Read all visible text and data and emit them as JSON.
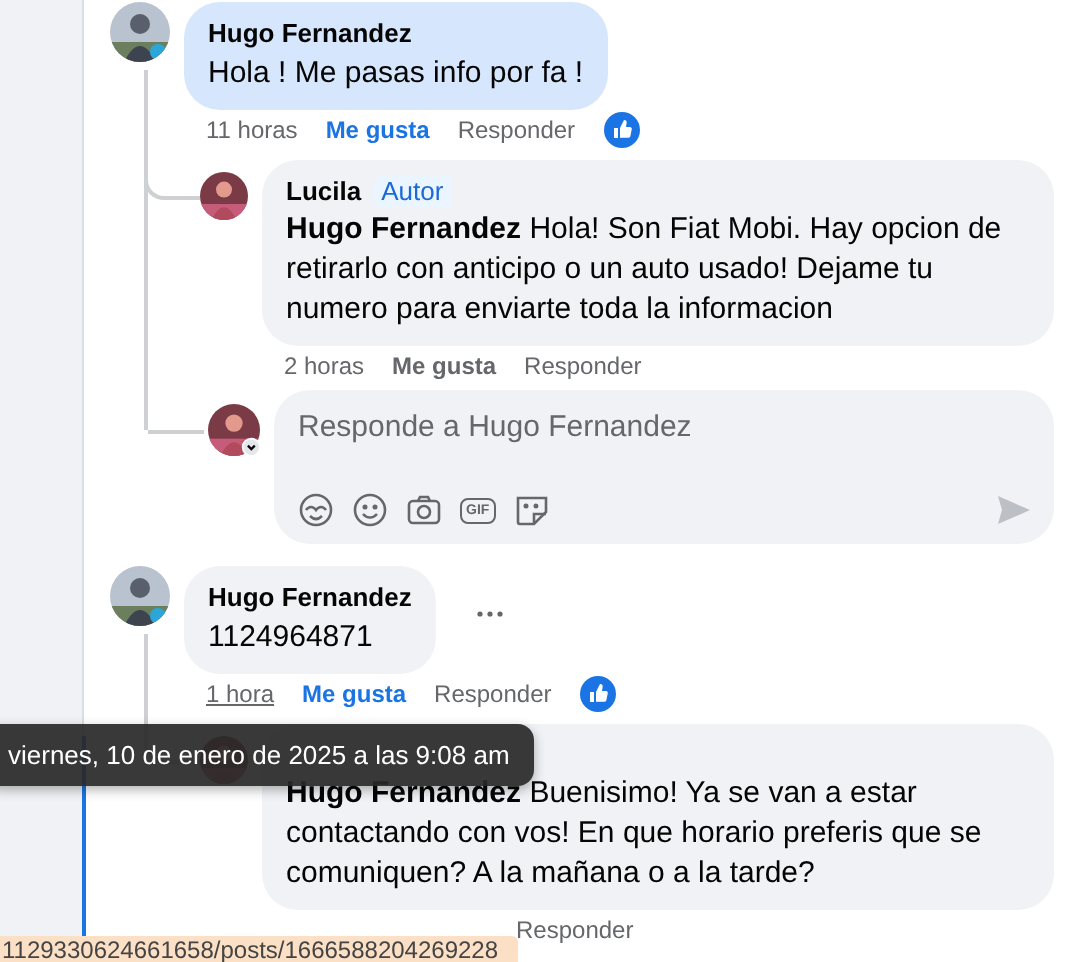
{
  "threads": [
    {
      "comment": {
        "author": "Hugo Fernandez",
        "text": "Hola ! Me pasas info por fa !",
        "highlighted": true,
        "more_button": false,
        "time": "11 horas",
        "time_hovered": false,
        "like": "Me gusta",
        "liked": true,
        "reply": "Responder",
        "reaction": true
      },
      "replies": [
        {
          "author": "Lucila",
          "badge": "Autor",
          "mention": "Hugo Fernandez",
          "text": "Hola! Son Fiat Mobi. Hay opcion de retirarlo con anticipo o un auto usado! Dejame tu numero para enviarte toda la informacion",
          "time": "2 horas",
          "like": "Me gusta",
          "liked": false,
          "reply": "Responder"
        }
      ],
      "composer": {
        "placeholder": "Responde a Hugo Fernandez",
        "gif_label": "GIF"
      }
    },
    {
      "comment": {
        "author": "Hugo Fernandez",
        "text": "1124964871",
        "highlighted": false,
        "more_button": true,
        "time": "1 hora",
        "time_hovered": true,
        "like": "Me gusta",
        "liked": true,
        "reply": "Responder",
        "reaction": true
      },
      "replies": [
        {
          "mention": "Hugo Fernandez",
          "text": "Buenisimo! Ya se van a estar contactando con vos! En que horario preferis que se comuniquen? A la mañana o a la tarde?",
          "reply": "Responder"
        }
      ]
    }
  ],
  "tooltip": {
    "text": "viernes, 10 de enero de 2025 a las 9:08 am"
  },
  "status_bar": {
    "url": "1129330624661658/posts/1666588204269228"
  }
}
